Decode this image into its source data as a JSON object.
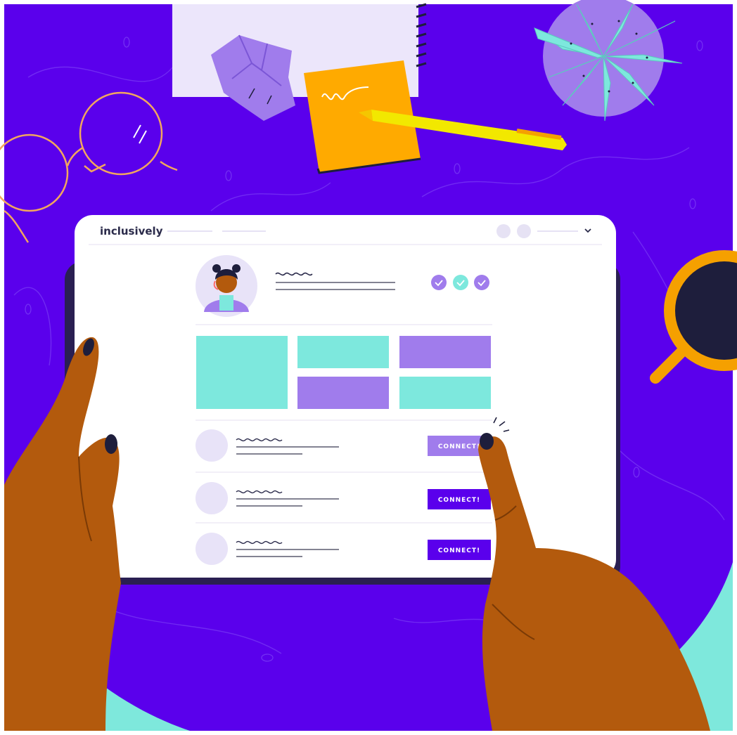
{
  "brand": {
    "logo_text": "inclusively"
  },
  "candidates": [
    {
      "connect_label": "CONNECT!"
    },
    {
      "connect_label": "CONNECT!"
    },
    {
      "connect_label": "CONNECT!"
    }
  ],
  "colors": {
    "table": "#5a00ec",
    "floor": "#7ee8dc",
    "accent_purple": "#a07cec",
    "accent_teal": "#7de8dd",
    "connect_primary": "#5a00ec",
    "connect_hover": "#a07cec",
    "skin": "#b35a0d",
    "sticky_note": "#ffaa00",
    "pen": "#f2e800",
    "coffee_mug": "#f5a000"
  },
  "icons": [
    "glasses-icon",
    "notebook-icon",
    "crumpled-paper-icon",
    "sticky-note-icon",
    "pen-icon",
    "plant-icon",
    "coffee-mug-icon",
    "check-icon",
    "chevron-down-icon",
    "avatar"
  ]
}
